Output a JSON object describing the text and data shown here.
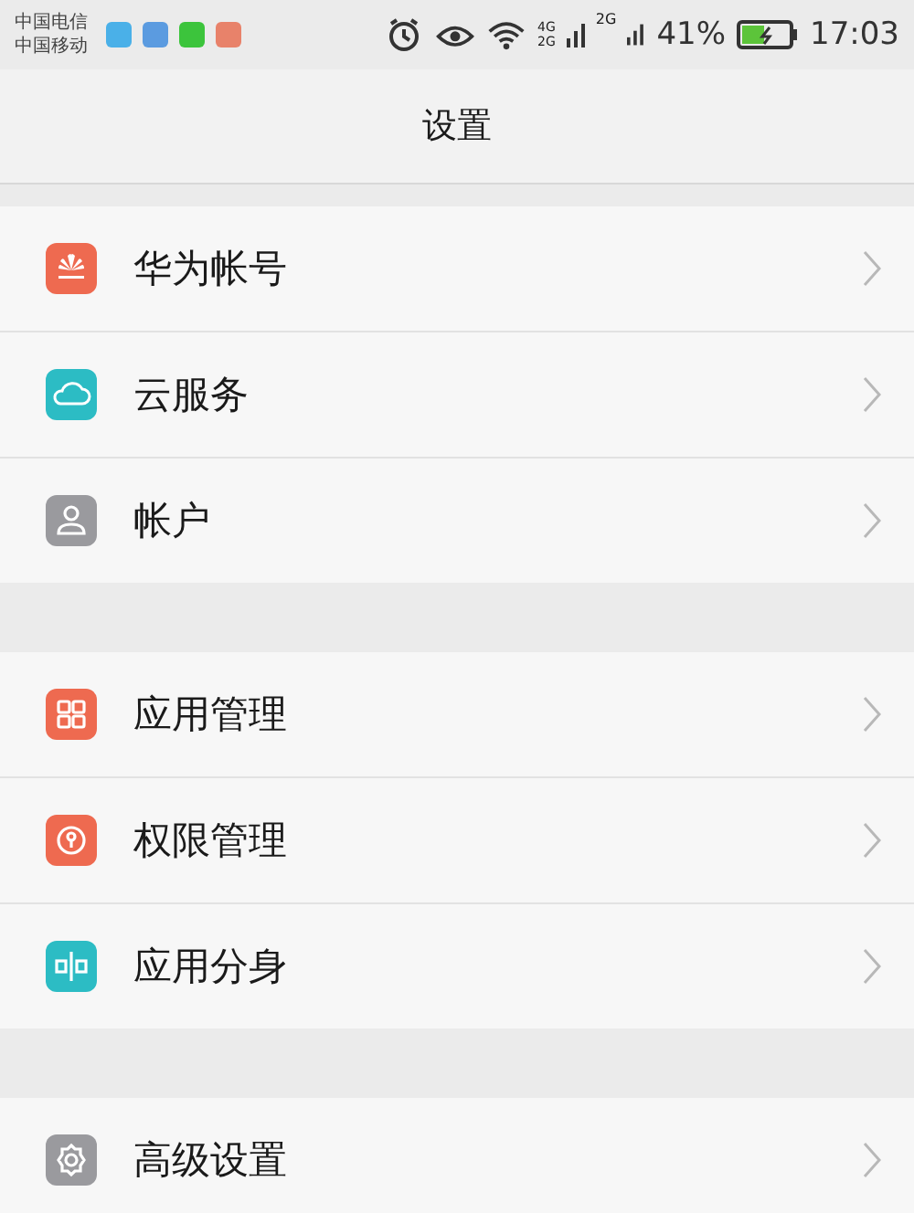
{
  "status_bar": {
    "carriers": [
      "中国电信",
      "中国移动"
    ],
    "notifications": [
      {
        "color": "#4ab0e8"
      },
      {
        "color": "#5b9be0"
      },
      {
        "color": "#3cc43c"
      },
      {
        "color": "#e8826a"
      }
    ],
    "network_labels": [
      "4G",
      "2G",
      "2G"
    ],
    "battery": "41%",
    "time": "17:03"
  },
  "title": "设置",
  "groups": [
    {
      "items": [
        {
          "label": "华为帐号",
          "kind": "huawei",
          "color": "#ee6a50"
        },
        {
          "label": "云服务",
          "kind": "cloud",
          "color": "#2cbcc4"
        },
        {
          "label": "帐户",
          "kind": "person",
          "color": "#9a9a9e"
        }
      ]
    },
    {
      "items": [
        {
          "label": "应用管理",
          "kind": "apps",
          "color": "#ee6a50"
        },
        {
          "label": "权限管理",
          "kind": "lock",
          "color": "#ee6a50"
        },
        {
          "label": "应用分身",
          "kind": "split",
          "color": "#2cbcc4"
        }
      ]
    },
    {
      "items": [
        {
          "label": "高级设置",
          "kind": "gear",
          "color": "#9a9a9e"
        }
      ]
    }
  ]
}
